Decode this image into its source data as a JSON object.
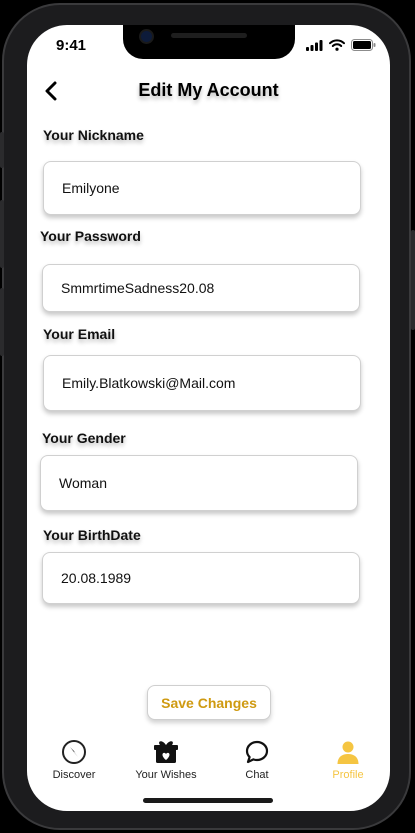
{
  "status_bar": {
    "time": "9:41"
  },
  "header": {
    "title": "Edit My Account"
  },
  "form": {
    "nickname": {
      "label": "Your Nickname",
      "value": "Emilyone"
    },
    "password": {
      "label": "Your Password",
      "value": "SmmrtimeSadness20.08"
    },
    "email": {
      "label": "Your Email",
      "value": "Emily.Blatkowski@Mail.com"
    },
    "gender": {
      "label": "Your Gender",
      "value": "Woman"
    },
    "birthdate": {
      "label": "Your BirthDate",
      "value": "20.08.1989"
    }
  },
  "save_label": "Save Changes",
  "tabs": [
    {
      "label": "Discover",
      "icon": "compass-icon"
    },
    {
      "label": "Your Wishes",
      "icon": "gift-box-icon"
    },
    {
      "label": "Chat",
      "icon": "chat-bubble-icon"
    },
    {
      "label": "Profile",
      "icon": "person-icon"
    }
  ],
  "colors": {
    "accent": "#f5c542",
    "save_text": "#cf9a11"
  }
}
